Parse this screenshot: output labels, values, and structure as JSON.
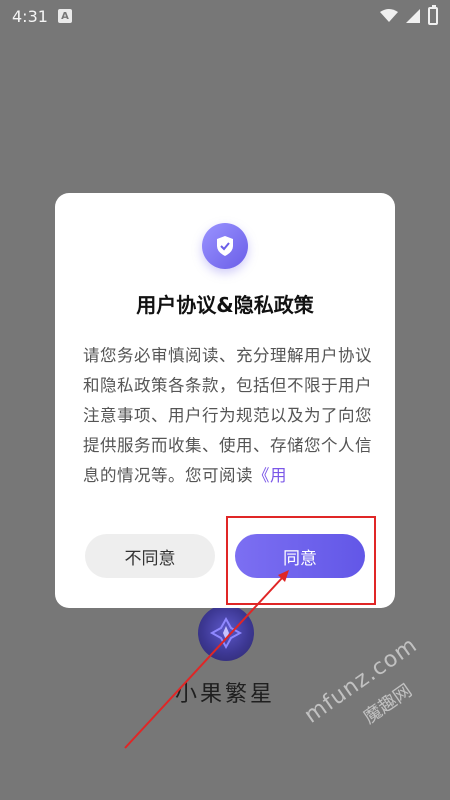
{
  "status_bar": {
    "time": "4:31",
    "notification_badge": "A"
  },
  "background": {
    "app_name": "小果繁星"
  },
  "dialog": {
    "title": "用户协议&隐私政策",
    "body_text": "请您务必审慎阅读、充分理解用户协议和隐私政策各条款，包括但不限于用户注意事项、用户行为规范以及为了向您提供服务而收集、使用、存储您个人信息的情况等。您可阅读",
    "body_link": "《用",
    "buttons": {
      "disagree": "不同意",
      "agree": "同意"
    }
  },
  "watermark": {
    "cn": "魔趣网",
    "en": "mfunz.com"
  },
  "colors": {
    "accent": "#6a5ee8",
    "overlay": "#777777",
    "annotation": "#e02626"
  },
  "icons": {
    "status": [
      "wifi-icon",
      "signal-icon",
      "battery-icon"
    ],
    "dialog": "shield-check-icon",
    "app": "app-logo-icon"
  }
}
